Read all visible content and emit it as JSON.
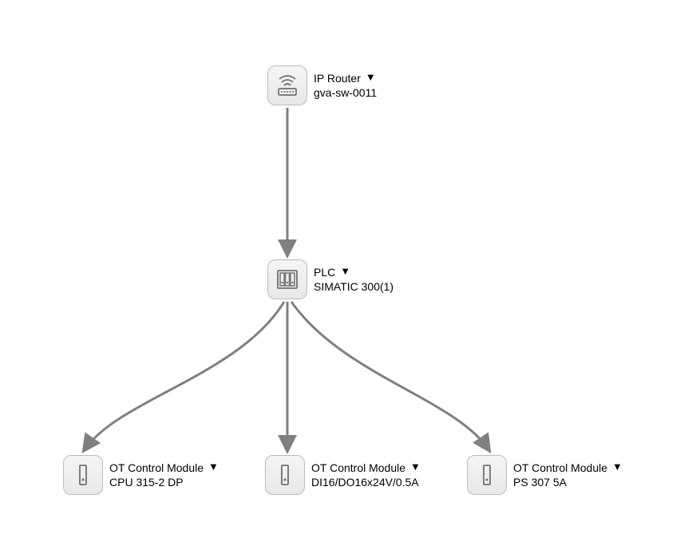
{
  "nodes": {
    "router": {
      "type_label": "IP Router",
      "name": "gva-sw-0011",
      "icon": "router-icon"
    },
    "plc": {
      "type_label": "PLC",
      "name": "SIMATIC 300(1)",
      "icon": "plc-icon"
    },
    "ot1": {
      "type_label": "OT Control Module",
      "name": "CPU 315-2 DP",
      "icon": "ot-icon"
    },
    "ot2": {
      "type_label": "OT Control Module",
      "name": "DI16/DO16x24V/0.5A",
      "icon": "ot-icon"
    },
    "ot3": {
      "type_label": "OT Control Module",
      "name": "PS 307 5A",
      "icon": "ot-icon"
    }
  },
  "edges": [
    {
      "from": "router",
      "to": "plc"
    },
    {
      "from": "plc",
      "to": "ot1"
    },
    {
      "from": "plc",
      "to": "ot2"
    },
    {
      "from": "plc",
      "to": "ot3"
    }
  ],
  "colors": {
    "edge": "#808080",
    "icon_stroke": "#707070",
    "node_bg_start": "#f5f5f5",
    "node_bg_end": "#e8e8e8",
    "node_border": "#bbbbbb"
  }
}
